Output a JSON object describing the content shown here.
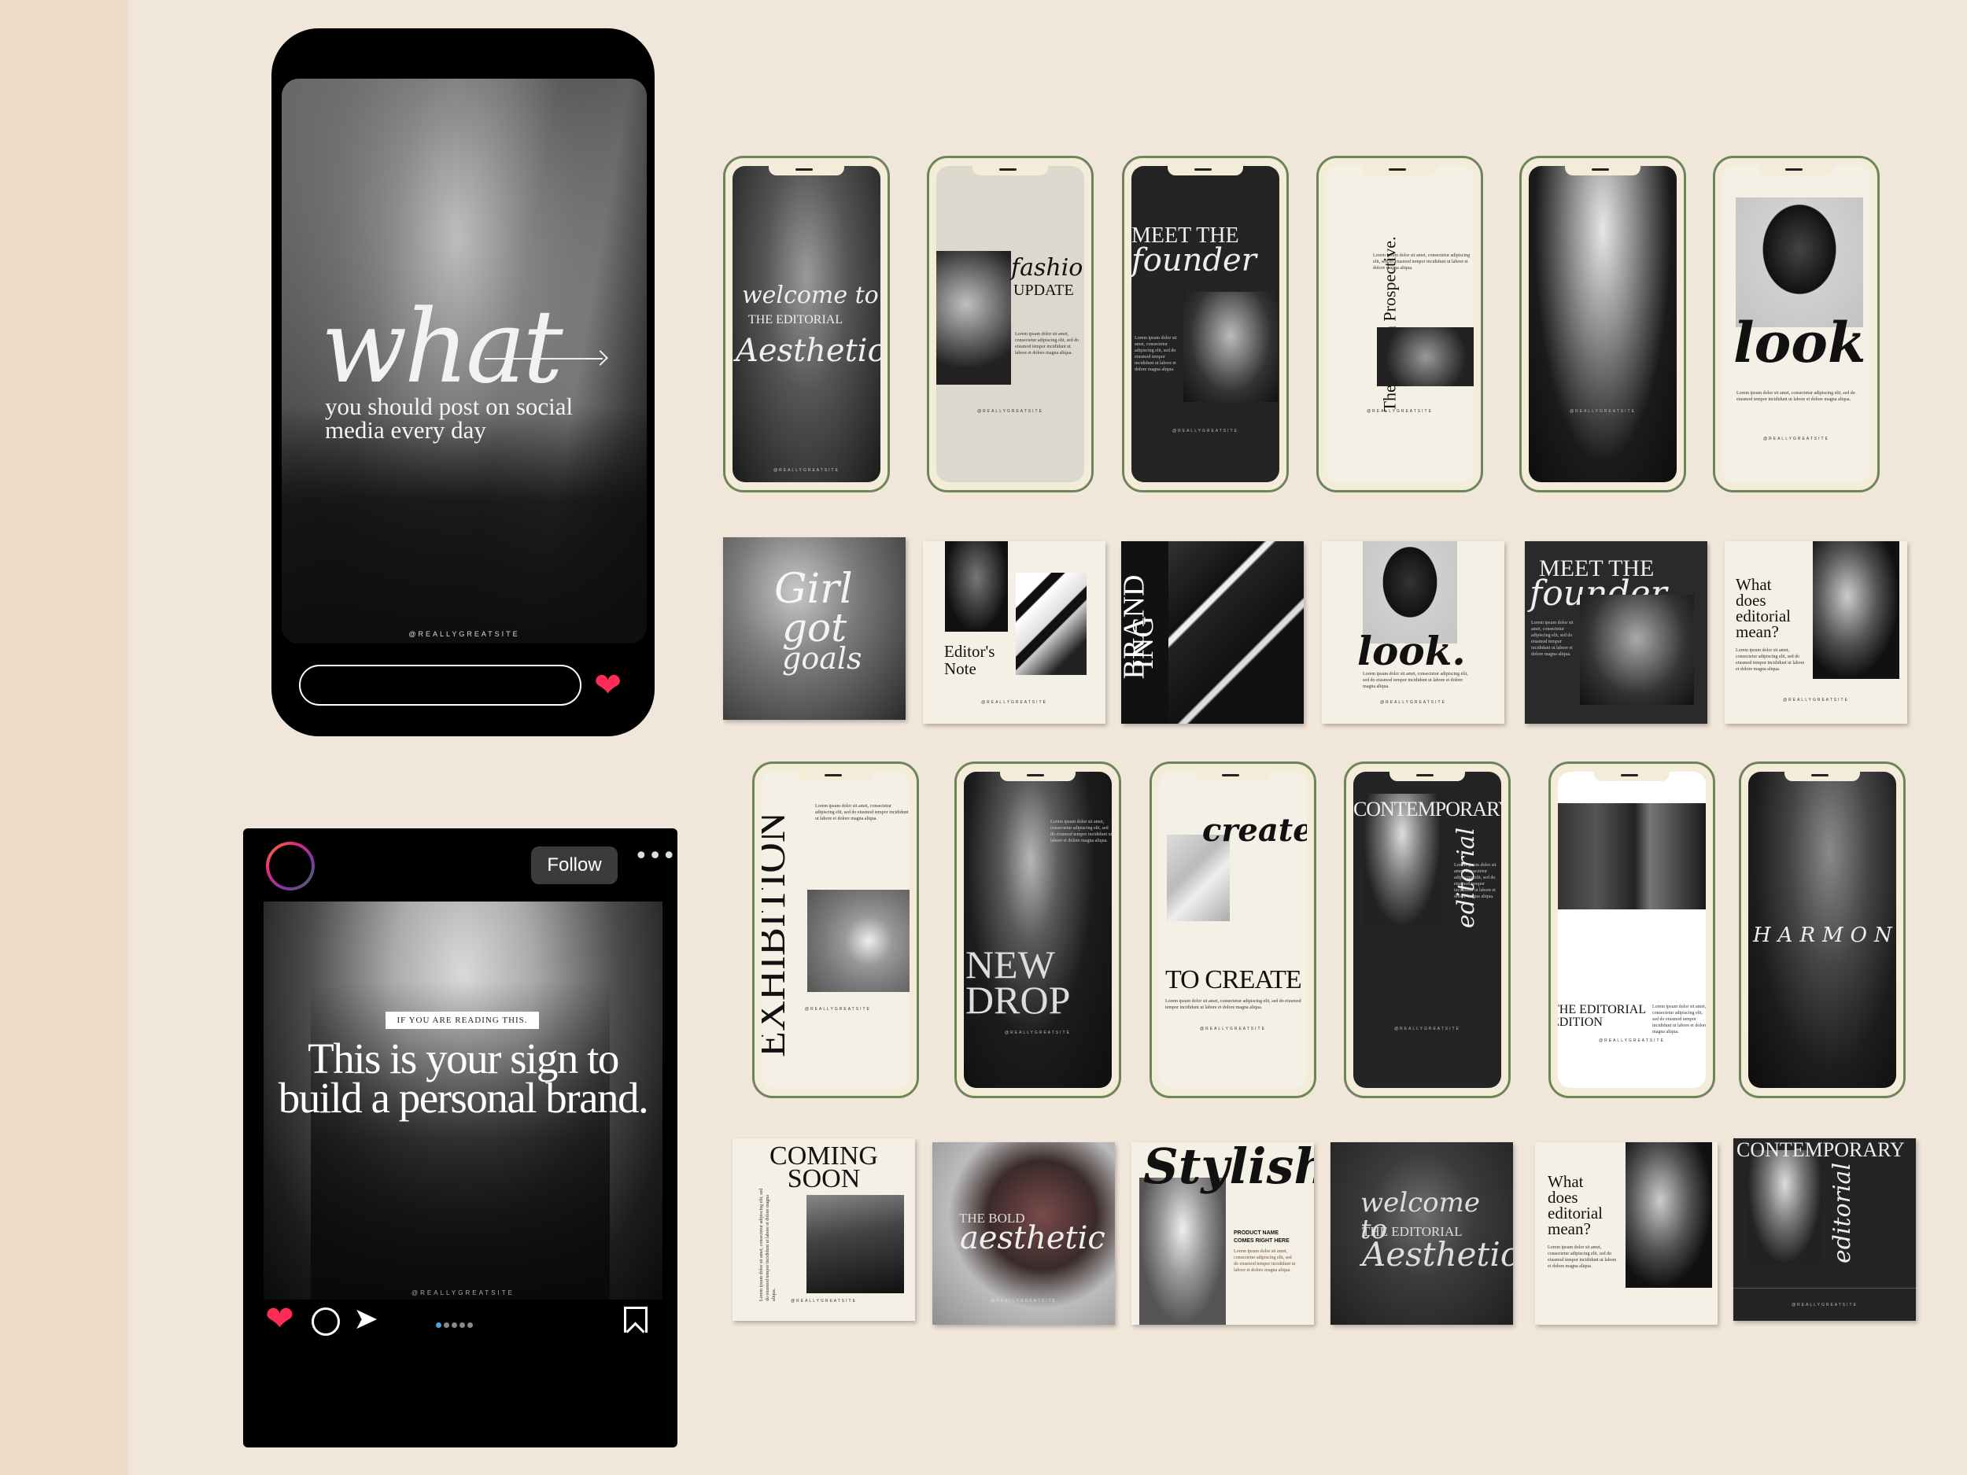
{
  "story": {
    "big_word": "what",
    "subtitle": "you should post on social media every day",
    "handle": "@REALLYGREATSITE"
  },
  "post": {
    "follow_label": "Follow",
    "more_label": "•••",
    "label": "IF YOU ARE READING THIS.",
    "title": "This is your sign to build a personal brand.",
    "handle": "@REALLYGREATSITE"
  },
  "templates": {
    "handle": "@REALLYGREATSITE",
    "lorem": "Lorem ipsum dolor sit amet, consectetur adipiscing elit, sed do eiusmod tempor incididunt ut labore et dolore magna aliqua.",
    "row1": {
      "p1": {
        "line1": "welcome to",
        "line2": "THE EDITORIAL",
        "line3": "Aesthetic"
      },
      "p2": {
        "line1": "fashion",
        "line2": "UPDATE"
      },
      "p3": {
        "line1": "MEET THE",
        "line2": "founder"
      },
      "p4": {
        "line1": "The Modern Prospective."
      },
      "p6": {
        "line1": "look."
      }
    },
    "row2": {
      "s1": {
        "line1": "Girl",
        "line2": "got",
        "line3": "goals"
      },
      "s2": {
        "line1": "Editor's",
        "line2": "Note"
      },
      "s3": {
        "line1": "BRAND",
        "line2": "ING"
      },
      "s4": {
        "line1": "look."
      },
      "s5": {
        "line1": "MEET THE",
        "line2": "founder"
      },
      "s6": {
        "line1": "What",
        "line2": "does",
        "line3": "editorial",
        "line4": "mean?"
      }
    },
    "row3": {
      "p1": {
        "line1": "EXHIBITION"
      },
      "p2": {
        "line1": "NEW",
        "line2": "DROP"
      },
      "p3": {
        "line1": "created",
        "line2": "TO CREATE"
      },
      "p4": {
        "line1": "CONTEMPORARY",
        "line2": "editorial"
      },
      "p5": {
        "line1": "THE EDITORIAL",
        "line2": "EDITION"
      },
      "p6": {
        "line1": "HARMONY"
      }
    },
    "row4": {
      "s1": {
        "line1": "COMING",
        "line2": "SOON"
      },
      "s2": {
        "line1": "THE BOLD",
        "line2": "aesthetic"
      },
      "s3": {
        "line1": "Stylish",
        "line2": "PRODUCT NAME",
        "line3": "COMES RIGHT HERE"
      },
      "s4": {
        "line1": "welcome to",
        "line2": "THE EDITORIAL",
        "line3": "Aesthetic"
      },
      "s5": {
        "line1": "What",
        "line2": "does",
        "line3": "editorial",
        "line4": "mean?"
      },
      "s6": {
        "line1": "CONTEMPORARY",
        "line2": "editorial"
      }
    }
  },
  "colors": {
    "background": "#f1e6da",
    "heart": "#ff2d55",
    "phone_frame": "#6f8559",
    "phone_body": "#f3ecd8"
  },
  "icons": [
    "arrow-right-icon",
    "heart-icon",
    "comment-icon",
    "send-icon",
    "bookmark-icon",
    "more-icon"
  ]
}
